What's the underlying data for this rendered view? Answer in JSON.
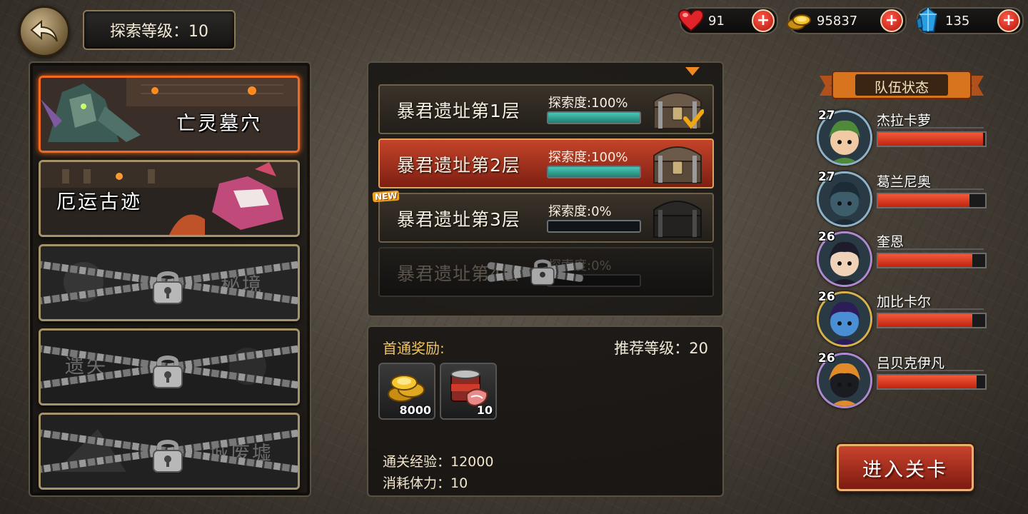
{
  "header": {
    "explore_level": "探索等级：10"
  },
  "resources": {
    "stamina": "91",
    "gold": "95837",
    "diamonds": "135"
  },
  "dungeons": [
    {
      "name": "亡灵墓穴",
      "state": "selected"
    },
    {
      "name": "厄运古迹",
      "state": "unlocked"
    },
    {
      "name": "秘境",
      "state": "locked"
    },
    {
      "name": "遗失",
      "state": "locked"
    },
    {
      "name": "城废墟",
      "state": "locked"
    }
  ],
  "floors": [
    {
      "name": "暴君遗址第1层",
      "progress_label": "探索度:100%",
      "progress": 1.0,
      "state": "cleared"
    },
    {
      "name": "暴君遗址第2层",
      "progress_label": "探索度:100%",
      "progress": 1.0,
      "state": "active"
    },
    {
      "name": "暴君遗址第3层",
      "progress_label": "探索度:0%",
      "progress": 0.0,
      "state": "new",
      "badge": "NEW"
    },
    {
      "name": "暴君遗址第4层",
      "progress_label": "探索度:0%",
      "progress": 0.0,
      "state": "locked"
    }
  ],
  "info": {
    "first_clear_label": "首通奖励:",
    "recommended_level": "推荐等级：20",
    "rewards": [
      {
        "icon": "gold-coins-icon",
        "count": "8000"
      },
      {
        "icon": "meat-can-icon",
        "count": "10"
      }
    ],
    "clear_exp": "通关经验：12000",
    "stamina_cost": "消耗体力：10"
  },
  "team": {
    "title": "队伍状态",
    "members": [
      {
        "level": "27",
        "name": "杰拉卡萝",
        "hp": 0.98,
        "ring": "#8fb3c9",
        "skin": "#f1c9a5",
        "hair": "#4f8a3a"
      },
      {
        "level": "27",
        "name": "葛兰尼奥",
        "hp": 0.85,
        "ring": "#8fb3c9",
        "skin": "#3d5d6a",
        "hair": "#1c2c36"
      },
      {
        "level": "26",
        "name": "奎恩",
        "hp": 0.88,
        "ring": "#b08ad0",
        "skin": "#efd2b8",
        "hair": "#1c1c2a"
      },
      {
        "level": "26",
        "name": "加比卡尔",
        "hp": 0.88,
        "ring": "#d9b24a",
        "skin": "#4a8fd6",
        "hair": "#2c1c5a"
      },
      {
        "level": "26",
        "name": "吕贝克伊凡",
        "hp": 0.92,
        "ring": "#b08ad0",
        "skin": "#1b1b22",
        "hair": "#e08a2a"
      }
    ]
  },
  "actions": {
    "enter": "进入关卡"
  },
  "colors": {
    "accent_orange": "#f06a24",
    "hp_red": "#e03a22",
    "progress_teal": "#3fb3a4"
  }
}
